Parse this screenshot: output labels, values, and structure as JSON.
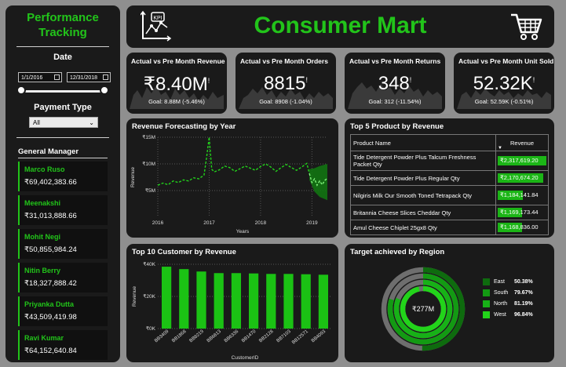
{
  "sidebar": {
    "title_line1": "Performance",
    "title_line2": "Tracking",
    "date_label": "Date",
    "date_start": "1/1/2016",
    "date_end": "12/31/2018",
    "slider_start_fraction": 0.0,
    "slider_end_fraction": 1.0,
    "payment_label": "Payment Type",
    "payment_selected": "All",
    "gm_label": "General Manager",
    "managers": [
      {
        "name": "Marco Ruso",
        "value": "₹69,402,383.66"
      },
      {
        "name": "Meenakshi",
        "value": "₹31,013,888.66"
      },
      {
        "name": "Mohit Negi",
        "value": "₹50,855,984.24"
      },
      {
        "name": "Nitin Berry",
        "value": "₹18,327,888.42"
      },
      {
        "name": "Priyanka Dutta",
        "value": "₹43,509,419.98"
      },
      {
        "name": "Ravi Kumar",
        "value": "₹64,152,640.84"
      }
    ]
  },
  "header": {
    "title": "Consumer Mart",
    "left_icon": "kpi-chart-icon",
    "right_icon": "shopping-cart-icon",
    "kpi_icon_text": "KPI"
  },
  "kpis": [
    {
      "title": "Actual vs Pre Month Revenue",
      "value": "₹8.40M",
      "flag": "!",
      "goal": "Goal: 8.88M (-5.46%)"
    },
    {
      "title": "Actual vs Pre Month Orders",
      "value": "8815",
      "flag": "!",
      "goal": "Goal: 8908 (-1.04%)"
    },
    {
      "title": "Actual vs Pre Month Returns",
      "value": "348",
      "flag": "!",
      "goal": "Goal: 312 (-11.54%)"
    },
    {
      "title": "Actual vs Pre Month Unit Sold",
      "value": "52.32K",
      "flag": "!",
      "goal": "Goal: 52.59K (-0.51%)"
    }
  ],
  "forecast": {
    "title": "Revenue Forecasting by Year",
    "chart_data": {
      "type": "line",
      "x_ticks": [
        "2016",
        "2017",
        "2018",
        "2019"
      ],
      "y_ticks": [
        "₹15M",
        "₹10M",
        "₹5M"
      ],
      "xlabel": "Years",
      "ylabel": "Revenue",
      "ylim": [
        0,
        15
      ],
      "xlim": [
        2016.0,
        2019.3
      ],
      "series": [
        {
          "values": [
            [
              2016.0,
              6.0
            ],
            [
              2016.1,
              6.4
            ],
            [
              2016.2,
              6.1
            ],
            [
              2016.3,
              6.8
            ],
            [
              2016.4,
              6.5
            ],
            [
              2016.5,
              7.0
            ],
            [
              2016.6,
              6.8
            ],
            [
              2016.7,
              7.4
            ],
            [
              2016.8,
              7.2
            ],
            [
              2016.9,
              7.9
            ],
            [
              2016.95,
              11.2
            ],
            [
              2017.0,
              15.0
            ],
            [
              2017.05,
              9.0
            ],
            [
              2017.1,
              8.5
            ],
            [
              2017.2,
              8.9
            ],
            [
              2017.3,
              9.6
            ],
            [
              2017.4,
              9.3
            ],
            [
              2017.5,
              8.6
            ],
            [
              2017.6,
              9.1
            ],
            [
              2017.7,
              9.6
            ],
            [
              2017.8,
              9.2
            ],
            [
              2017.9,
              8.8
            ],
            [
              2018.0,
              9.5
            ],
            [
              2018.1,
              10.0
            ],
            [
              2018.2,
              9.4
            ],
            [
              2018.3,
              8.6
            ],
            [
              2018.4,
              9.3
            ],
            [
              2018.5,
              9.9
            ],
            [
              2018.6,
              9.3
            ],
            [
              2018.7,
              8.8
            ],
            [
              2018.8,
              9.4
            ],
            [
              2018.9,
              10.1
            ],
            [
              2018.95,
              8.2
            ]
          ]
        },
        {
          "values": [
            [
              2018.95,
              8.2
            ],
            [
              2019.0,
              6.5
            ],
            [
              2019.05,
              7.2
            ],
            [
              2019.1,
              6.0
            ],
            [
              2019.15,
              6.8
            ],
            [
              2019.2,
              6.1
            ],
            [
              2019.25,
              6.9
            ],
            [
              2019.3,
              7.3
            ]
          ]
        }
      ],
      "forecast_band": {
        "upper": [
          [
            2018.95,
            9.0
          ],
          [
            2019.05,
            9.2
          ],
          [
            2019.15,
            9.6
          ],
          [
            2019.3,
            10.0
          ]
        ],
        "lower": [
          [
            2018.95,
            7.0
          ],
          [
            2019.05,
            4.8
          ],
          [
            2019.15,
            3.8
          ],
          [
            2019.3,
            3.2
          ]
        ]
      }
    }
  },
  "top5": {
    "title": "Top 5 Product by Revenue",
    "col_product": "Product Name",
    "col_revenue": "Revenue",
    "max_value": 2317619.2,
    "rows": [
      {
        "name": "Tide Detergent Powder Plus Talcum Freshness Packet Qty",
        "value": 2317619.2,
        "label": "₹2,317,619.20"
      },
      {
        "name": "Tide Detergent Powder Plus Regular Qty",
        "value": 2170674.2,
        "label": "₹2,170,674.20"
      },
      {
        "name": "Nilgiris Milk Our Smooth Toned Tetrapack Qty",
        "value": 1184141.84,
        "label": "₹1,184,141.84"
      },
      {
        "name": "Britannia Cheese Slices Cheddar Qty",
        "value": 1169173.44,
        "label": "₹1,169,173.44"
      },
      {
        "name": "Amul Cheese Chiplet 25gx8 Qty",
        "value": 1168836.0,
        "label": "₹1,168,836.00"
      }
    ]
  },
  "customers": {
    "title": "Top 10 Customer by Revenue",
    "chart_data": {
      "type": "bar",
      "categories": [
        "BB3409",
        "BB1868",
        "BB8219",
        "BB6813",
        "BB6336",
        "BB1470",
        "BB2128",
        "BB7103",
        "BB12571",
        "BB4093"
      ],
      "values": [
        38.5,
        37.0,
        35.5,
        34.5,
        34.5,
        34.3,
        34.0,
        34.0,
        33.8,
        33.5
      ],
      "xlabel": "CustomerID",
      "ylabel": "Revenue",
      "y_ticks": [
        "₹40K",
        "₹20K",
        "₹0K"
      ],
      "ylim": [
        0,
        40
      ]
    }
  },
  "region": {
    "title": "Target achieved by Region",
    "center_label": "₹277M",
    "chart_data": {
      "type": "pie",
      "variant": "radial-rings",
      "series": [
        {
          "name": "East",
          "value": 50.38,
          "label": "50.38%",
          "color": "#0e6b0e"
        },
        {
          "name": "South",
          "value": 79.67,
          "label": "79.67%",
          "color": "#139a13"
        },
        {
          "name": "North",
          "value": 81.19,
          "label": "81.19%",
          "color": "#17b117"
        },
        {
          "name": "West",
          "value": 96.84,
          "label": "96.84%",
          "color": "#22d41a"
        }
      ]
    }
  },
  "colors": {
    "accent": "#22c41a",
    "panel": "#1a1a1a",
    "background": "#8f8f8f"
  }
}
